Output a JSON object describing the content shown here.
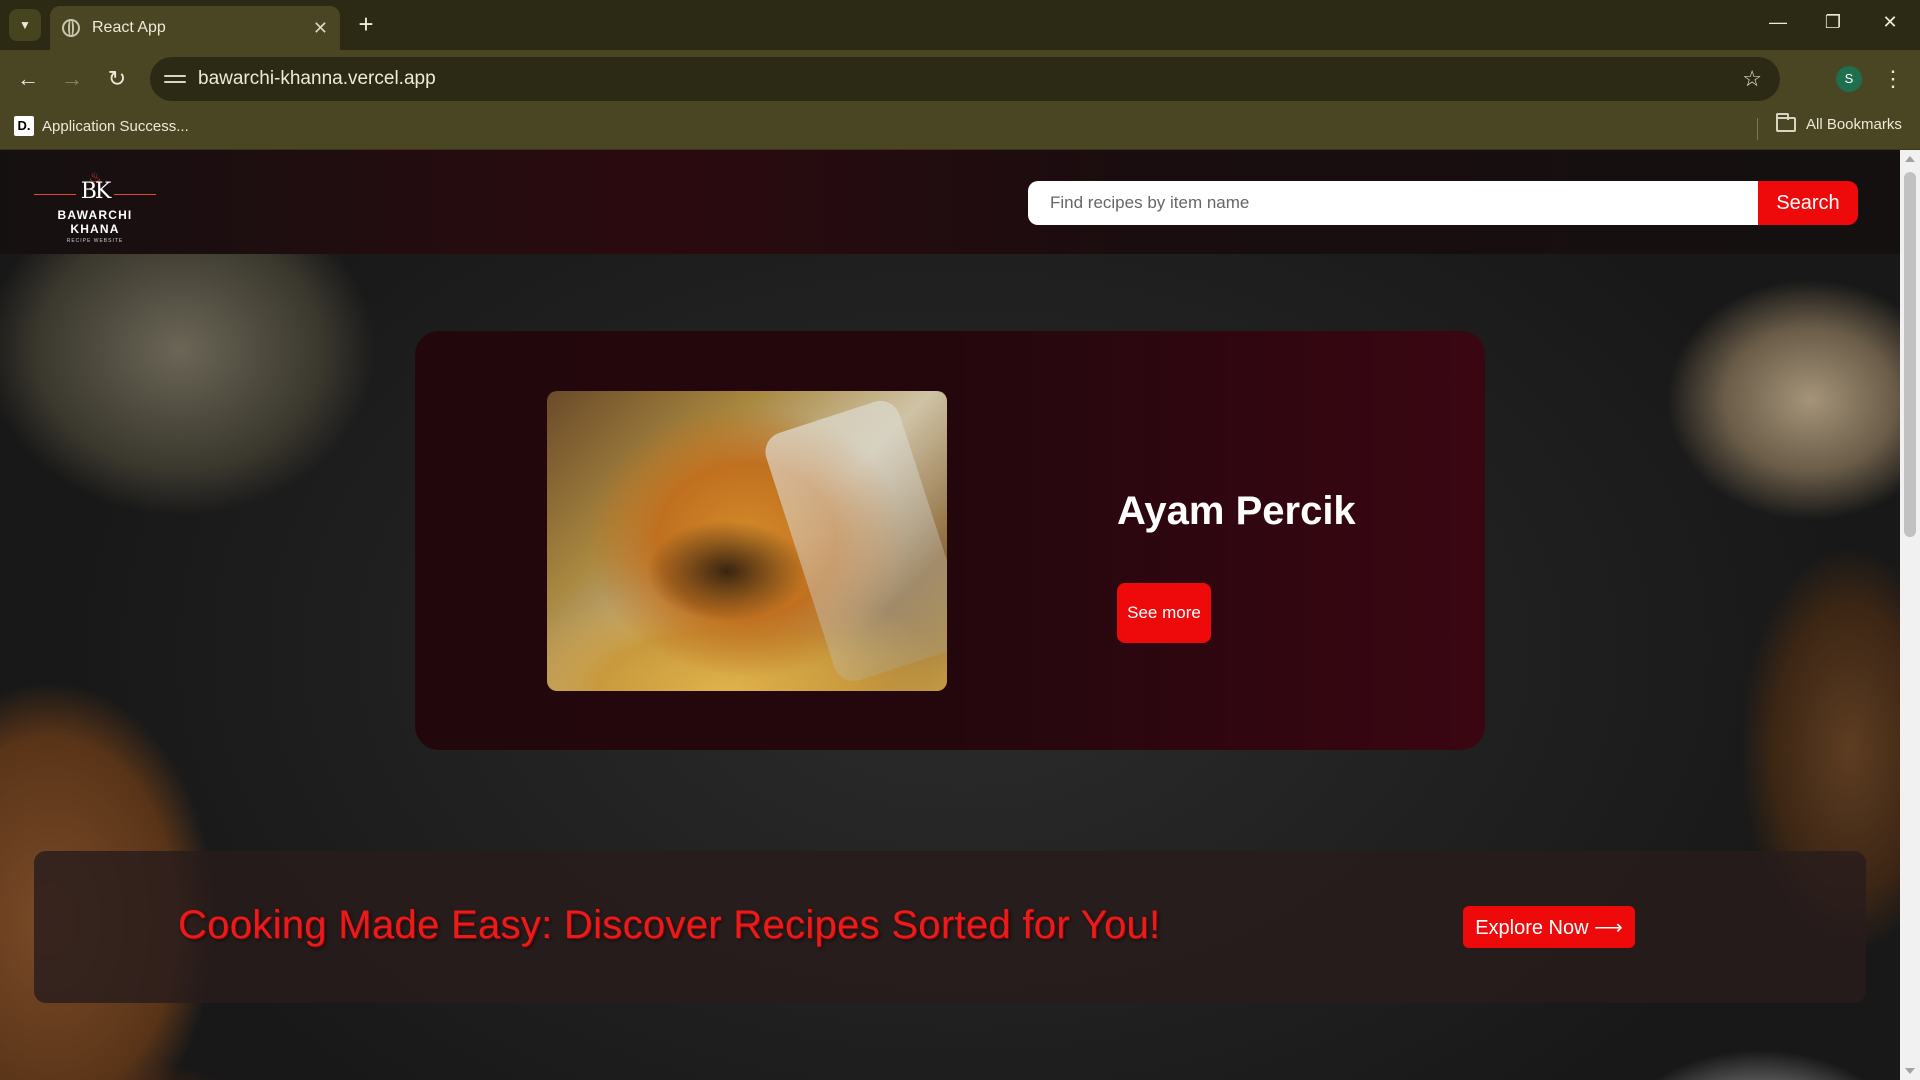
{
  "browser": {
    "tab_title": "React App",
    "url": "bawarchi-khanna.vercel.app",
    "profile_initial": "S",
    "bookmark_label": "Application Success...",
    "bookmark_favicon": "D.",
    "all_bookmarks_label": "All Bookmarks"
  },
  "site": {
    "logo": {
      "monogram": "BK",
      "name": "BAWARCHI KHANA",
      "tagline": "RECIPE WEBSITE"
    },
    "search": {
      "placeholder": "Find recipes by item name",
      "button_label": "Search"
    },
    "featured": {
      "dish_name": "Ayam Percik",
      "button_label": "See more"
    },
    "banner": {
      "headline": "Cooking Made Easy: Discover Recipes Sorted for You!",
      "button_label": "Explore Now ⟶"
    }
  },
  "colors": {
    "accent_red": "#ee0a0a",
    "headline_red": "#ee1a1a",
    "card_dark": "#22070d",
    "chrome_olive": "#4a4523"
  },
  "icons": [
    "tab-list-icon",
    "globe-icon",
    "close-icon",
    "plus-icon",
    "minimize-icon",
    "restore-icon",
    "window-close-icon",
    "back-arrow-icon",
    "forward-arrow-icon",
    "reload-icon",
    "site-settings-icon",
    "star-icon",
    "menu-dots-icon",
    "folder-icon"
  ]
}
